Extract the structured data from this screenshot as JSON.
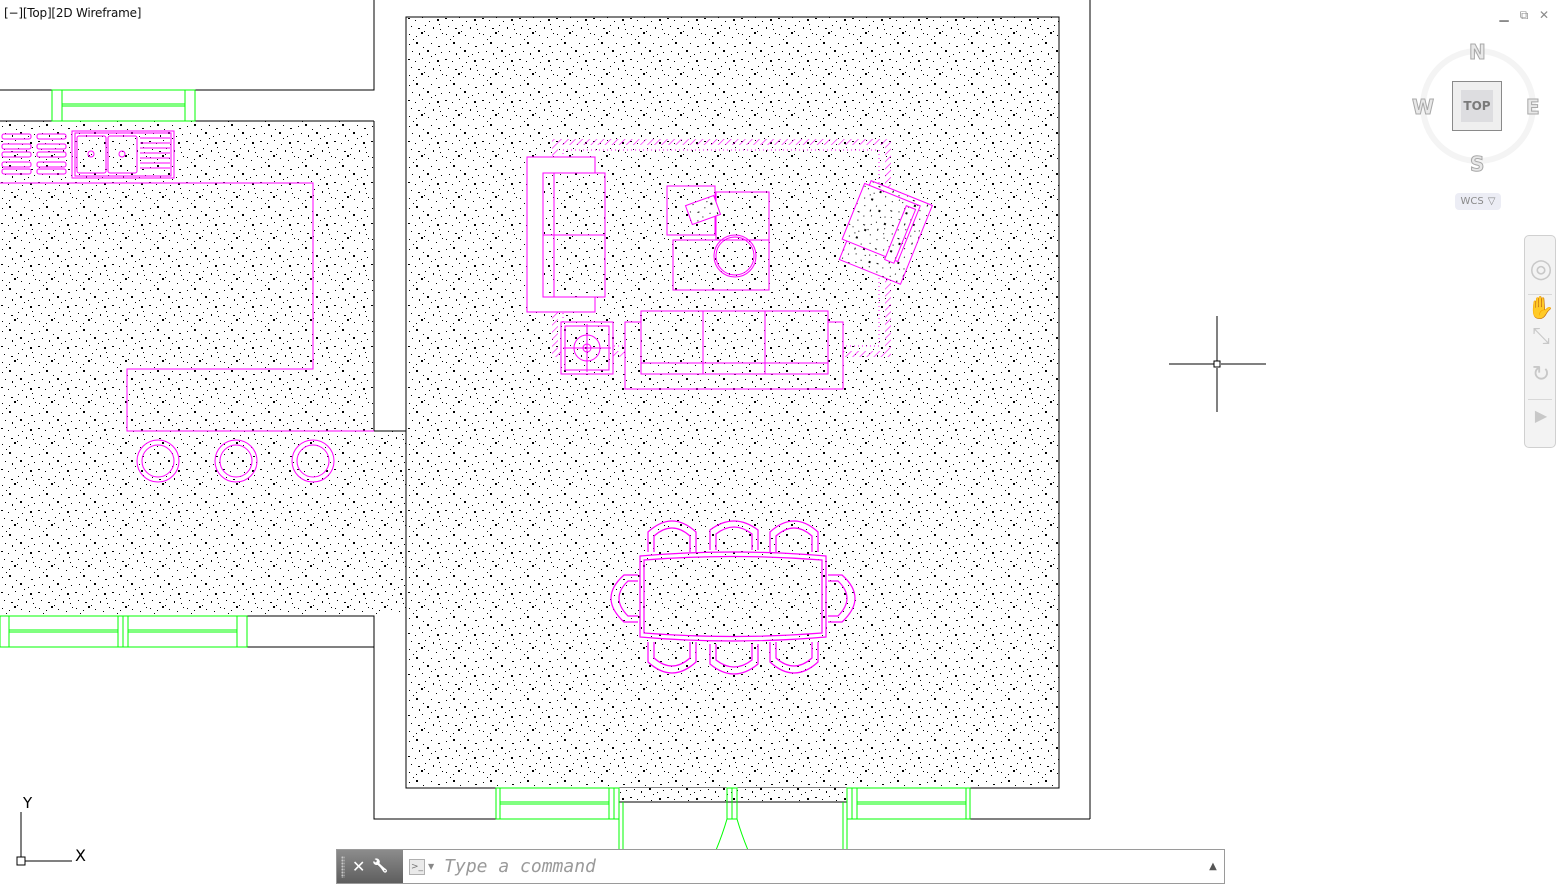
{
  "viewport": {
    "label": "[−][Top][2D Wireframe]",
    "controls": [
      {
        "name": "minimize",
        "glyph": "▁"
      },
      {
        "name": "restore",
        "glyph": "⧉"
      },
      {
        "name": "close",
        "glyph": "✕"
      }
    ]
  },
  "viewcube": {
    "face": "TOP",
    "north": "N",
    "south": "S",
    "east": "E",
    "west": "W",
    "ucs_label": "WCS",
    "ucs_dropdown_glyph": "▽"
  },
  "navigation_bar": {
    "items": [
      {
        "name": "steering-wheel",
        "glyph": "◎"
      },
      {
        "name": "pan",
        "glyph": "✋"
      },
      {
        "name": "zoom-extents",
        "glyph": "⤡"
      },
      {
        "name": "orbit",
        "glyph": "↻"
      },
      {
        "name": "showmotion",
        "glyph": "▶"
      }
    ]
  },
  "ucs_icon": {
    "x_label": "X",
    "y_label": "Y"
  },
  "command_line": {
    "close_glyph": "✕",
    "customize_glyph": "🔧",
    "prompt_glyph": ">_",
    "placeholder": "Type a command",
    "value": "",
    "history_glyph": "▲"
  },
  "colors": {
    "furniture": "#ff00ff",
    "windows": "#00ff00",
    "walls": "#000000",
    "hatch": "#000000",
    "background": "#ffffff"
  }
}
